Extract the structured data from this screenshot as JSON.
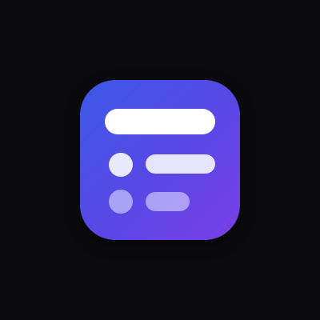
{
  "background_color": "#0b0b0d",
  "app_icon": {
    "icon": "list-summary-icon",
    "gradient_start": "#3b59e6",
    "gradient_end": "#7a3fe6",
    "glyph_color": "#ffffff"
  }
}
